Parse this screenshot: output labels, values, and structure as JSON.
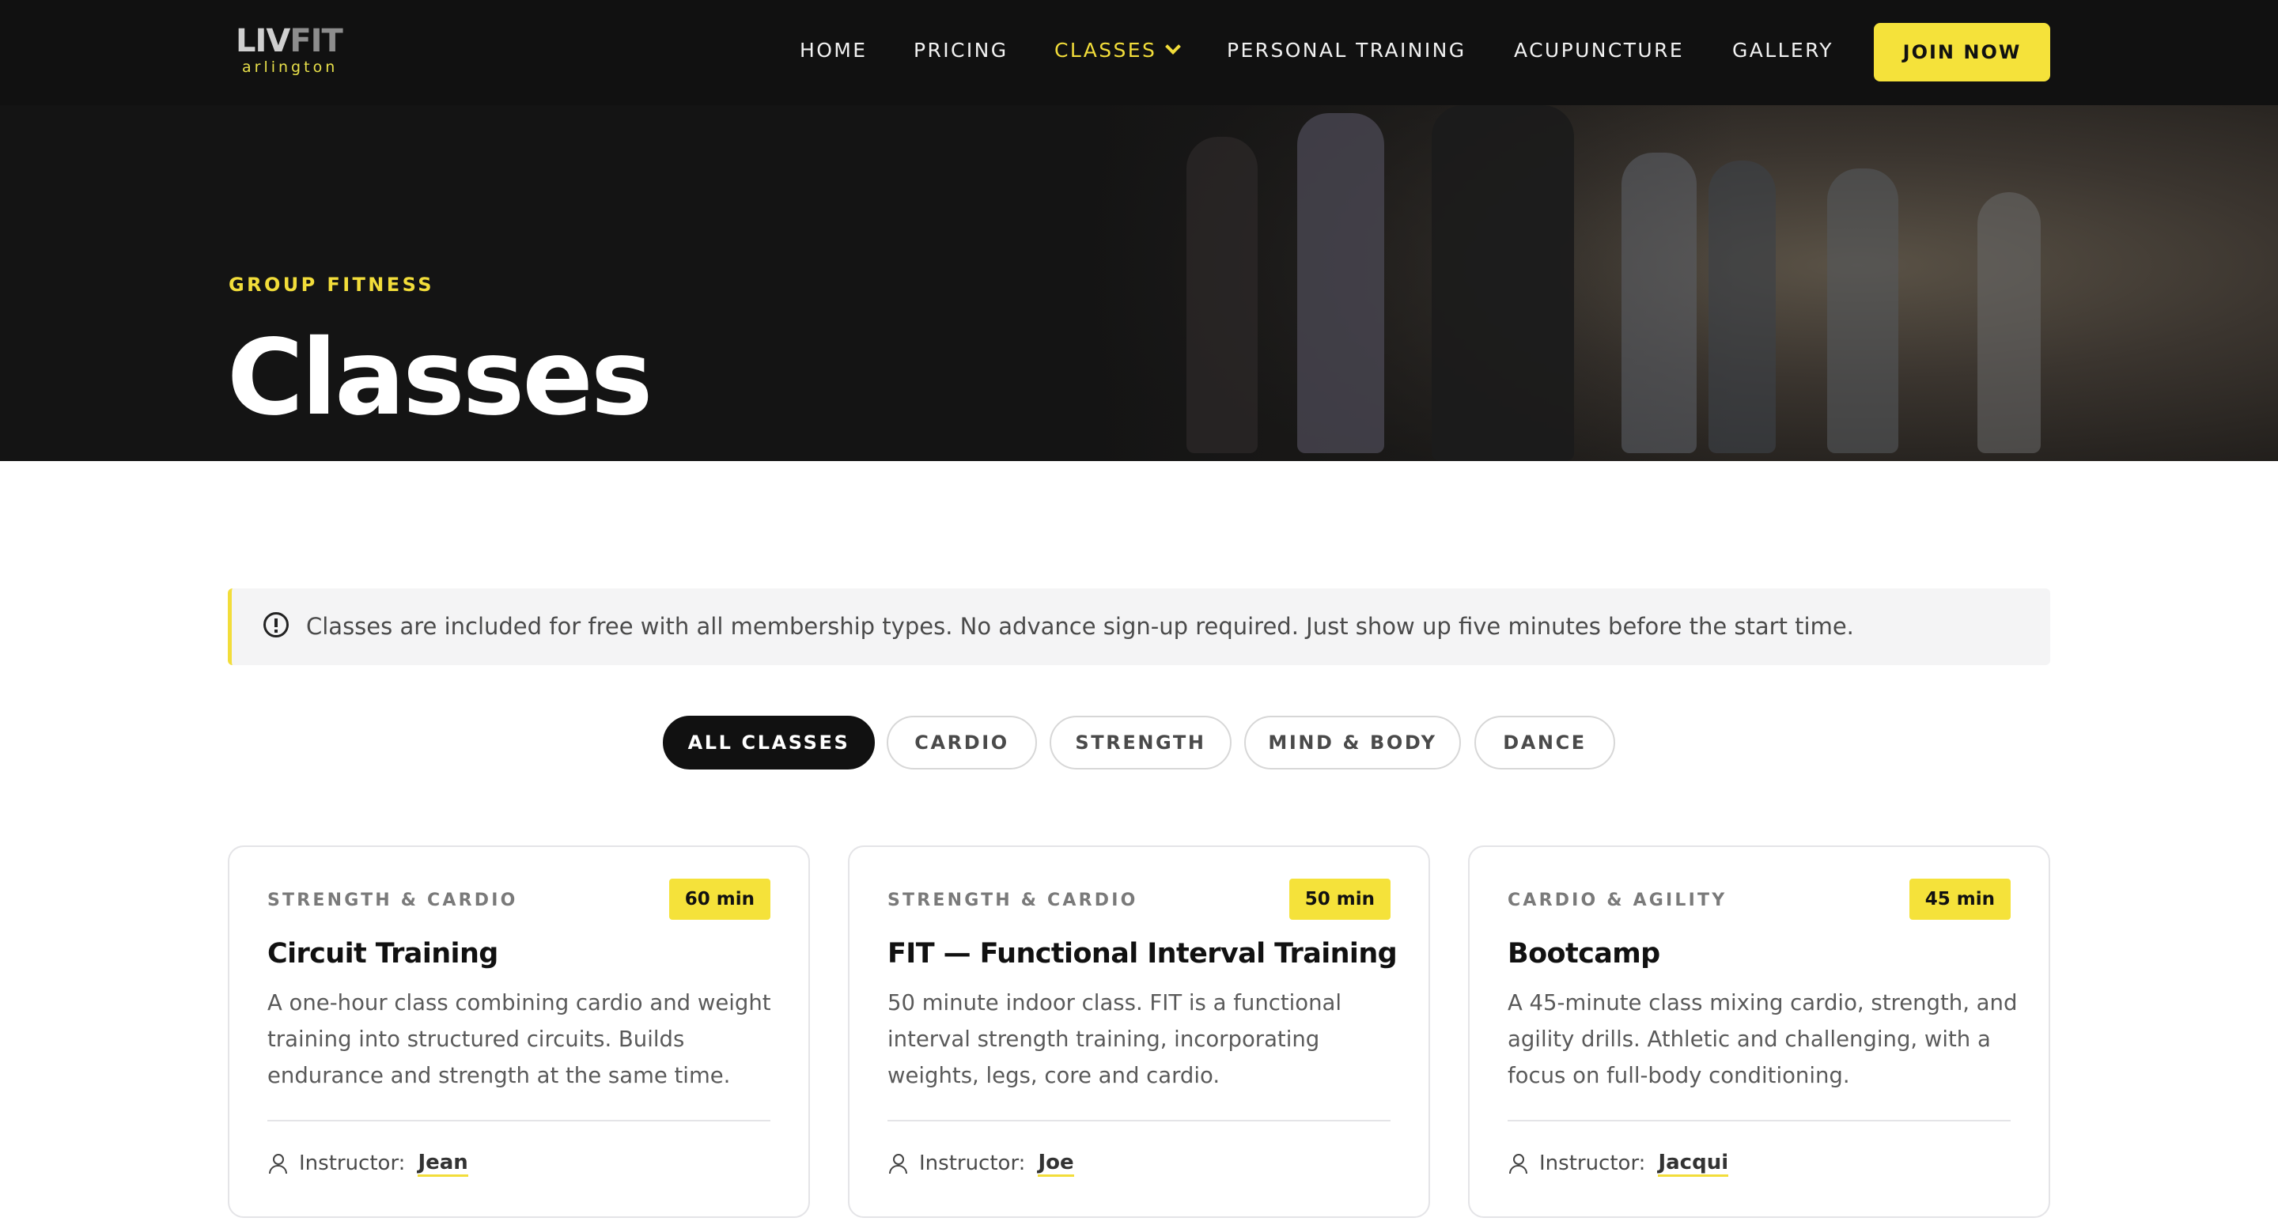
{
  "brand": {
    "logo_main": "LIV",
    "logo_accent": "FIT",
    "logo_sub": "arlington"
  },
  "nav": {
    "items": [
      {
        "label": "HOME"
      },
      {
        "label": "PRICING"
      },
      {
        "label": "CLASSES",
        "active": true
      },
      {
        "label": "PERSONAL TRAINING"
      },
      {
        "label": "ACUPUNCTURE"
      },
      {
        "label": "GALLERY"
      }
    ],
    "cta": "JOIN NOW"
  },
  "hero": {
    "eyebrow": "GROUP FITNESS",
    "title": "Classes"
  },
  "notice": {
    "text": "Classes are included for free with all membership types. No advance sign-up required. Just show up five minutes before the start time.",
    "icon": "info-icon"
  },
  "filters": [
    {
      "label": "ALL CLASSES",
      "active": true
    },
    {
      "label": "CARDIO"
    },
    {
      "label": "STRENGTH"
    },
    {
      "label": "MIND & BODY"
    },
    {
      "label": "DANCE"
    }
  ],
  "cards": [
    {
      "category": "STRENGTH & CARDIO",
      "duration": "60 min",
      "title": "Circuit Training",
      "description": "A one-hour class combining cardio and weight training into structured circuits. Builds endurance and strength at the same time.",
      "instructor_label": "Instructor:",
      "instructor": "Jean"
    },
    {
      "category": "STRENGTH & CARDIO",
      "duration": "50 min",
      "title": "FIT — Functional Interval Training",
      "description": "50 minute indoor class. FIT is a functional interval strength training, incorporating weights, legs, core and cardio.",
      "instructor_label": "Instructor:",
      "instructor": "Joe"
    },
    {
      "category": "CARDIO & AGILITY",
      "duration": "45 min",
      "title": "Bootcamp",
      "description": "A 45-minute class mixing cardio, strength, and agility drills. Athletic and challenging, with a focus on full-body conditioning.",
      "instructor_label": "Instructor:",
      "instructor": "Jacqui"
    }
  ],
  "colors": {
    "accent": "#f2dd3a",
    "dark": "#111111",
    "card_border": "#e4e4e7"
  }
}
